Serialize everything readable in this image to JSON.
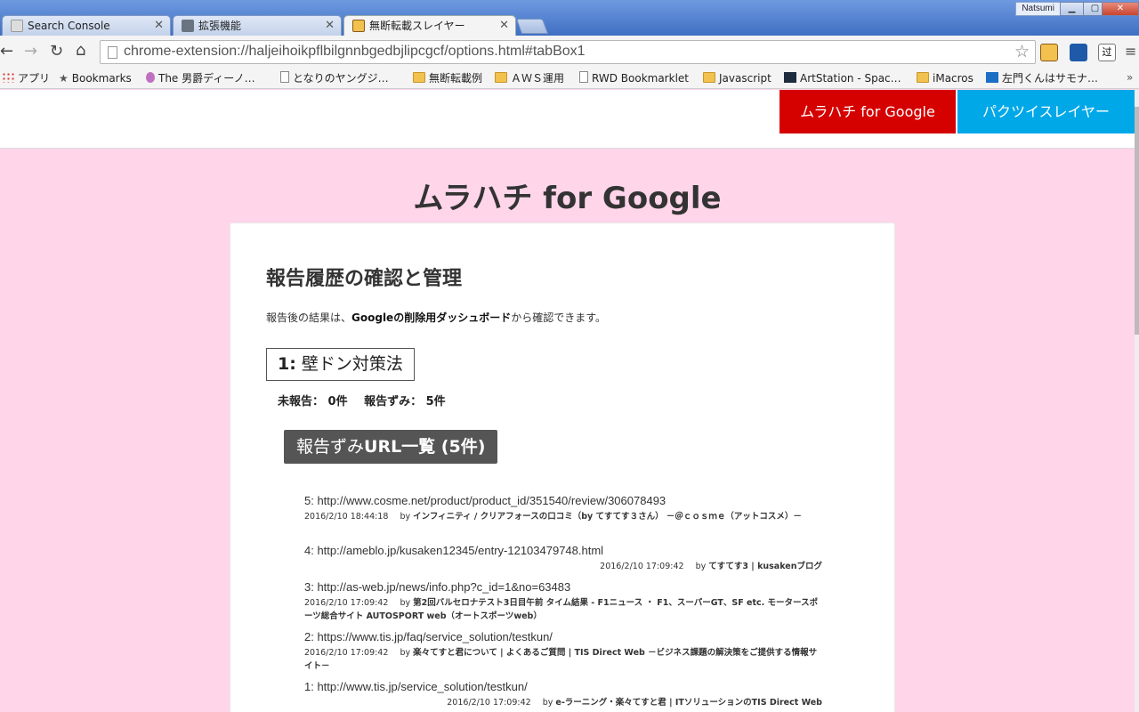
{
  "browser": {
    "tabs": [
      {
        "title": "Search Console",
        "active": false
      },
      {
        "title": "拡張機能",
        "active": false
      },
      {
        "title": "無断転載スレイヤー",
        "active": true
      }
    ],
    "user": "Natsumi",
    "window_controls": {
      "minimize": "▁",
      "maximize": "▢",
      "close": "✕"
    },
    "url": "chrome-extension://haljeihoikpflbilgnnbgedbjlipcgcf/options.html#tabBox1",
    "bookmarks": [
      {
        "label": "アプリ",
        "icon": "apps-icon"
      },
      {
        "label": "Bookmarks",
        "icon": "star-icon"
      },
      {
        "label": "The 男爵ディーノ…",
        "icon": "site-icon"
      },
      {
        "label": "となりのヤングジ…",
        "icon": "page-icon"
      },
      {
        "label": "無断転載例",
        "icon": "folder-icon"
      },
      {
        "label": "ＡＷＳ運用",
        "icon": "folder-icon"
      },
      {
        "label": "RWD Bookmarklet",
        "icon": "page-icon"
      },
      {
        "label": "Javascript",
        "icon": "folder-icon"
      },
      {
        "label": "ArtStation - Spac…",
        "icon": "site-icon"
      },
      {
        "label": "iMacros",
        "icon": "folder-icon"
      },
      {
        "label": "左門くんはサモナ…",
        "icon": "site-icon"
      }
    ]
  },
  "header": {
    "btn_murahachi": "ムラハチ for Google",
    "btn_pakutsui": "パクツイスレイヤー"
  },
  "page": {
    "title": "ムラハチ for Google",
    "section_title": "報告履歴の確認と管理",
    "lead_prefix": "報告後の結果は、",
    "lead_link": "Googleの削除用ダッシュボード",
    "lead_suffix": "から確認できます。",
    "keyword_num": "1:",
    "keyword": "壁ドン対策法",
    "unreported": "未報告： 0件",
    "reported": "報告ずみ： 5件",
    "list_button_prefix": "報告ずみ",
    "list_button_bold": "URL一覧 (5件)"
  },
  "entries": [
    {
      "url": "5: http://www.cosme.net/product/product_id/351540/review/306078493",
      "time": "2016/2/10 18:44:18",
      "by": "by",
      "site": "インフィニティ / クリアフォースの口コミ（by てすてす３さん） －＠ｃｏｓｍｅ（アットコスメ）－",
      "align": "left"
    },
    {
      "url": "4: http://ameblo.jp/kusaken12345/entry-12103479748.html",
      "time": "2016/2/10 17:09:42",
      "by": "by",
      "site": "てすてす3 | kusakenブログ",
      "align": "right"
    },
    {
      "url": "3: http://as-web.jp/news/info.php?c_id=1&no=63483",
      "time": "2016/2/10 17:09:42",
      "by": "by",
      "site": "第2回バルセロナテスト3日目午前 タイム結果 - F1ニュース ・ F1、スーパーGT、SF etc. モータースポーツ総合サイト AUTOSPORT web（オートスポーツweb）",
      "align": "left"
    },
    {
      "url": "2: https://www.tis.jp/faq/service_solution/testkun/",
      "time": "2016/2/10 17:09:42",
      "by": "by",
      "site": "楽々てすと君について | よくあるご質問 | TIS Direct Web －ビジネス課題の解決策をご提供する情報サイト－",
      "align": "left"
    },
    {
      "url": "1: http://www.tis.jp/service_solution/testkun/",
      "time": "2016/2/10 17:09:42",
      "by": "by",
      "site": "e-ラーニング・楽々てすと君 | ITソリューションのTIS Direct Web",
      "align": "right"
    }
  ],
  "colors": {
    "page_bg": "#ffd5ea",
    "red_btn": "#d50000",
    "blue_btn": "#00a8e8",
    "dark_btn": "#555555"
  }
}
